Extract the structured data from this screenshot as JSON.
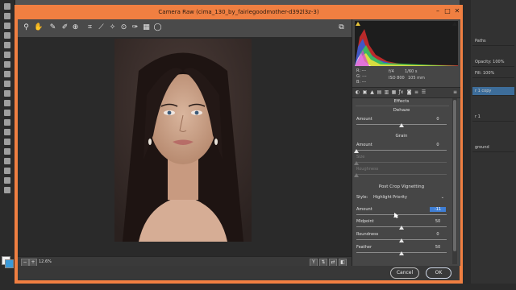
{
  "window": {
    "title": "Camera Raw (cima_130_by_fairiegoodmother-d392l3z-3)"
  },
  "toolbar": {
    "tools": [
      "zoom-tool",
      "hand-tool",
      "white-balance-tool",
      "color-sampler-tool",
      "targeted-adjustment-tool",
      "crop-tool",
      "straighten-tool",
      "spot-removal-tool",
      "red-eye-tool",
      "adjustment-brush",
      "graduated-filter",
      "radial-filter",
      "rotate-tool"
    ],
    "open_preferences": "preferences-icon"
  },
  "status": {
    "zoom": "12.6%"
  },
  "camera_info": {
    "r_label": "R:",
    "g_label": "G:",
    "b_label": "B:",
    "r": "---",
    "g": "---",
    "b": "---",
    "aperture": "f/4",
    "shutter": "1/60 s",
    "iso": "ISO 800",
    "focal": "105 mm"
  },
  "effects": {
    "panel_title": "Effects",
    "dehaze": {
      "title": "Dehaze",
      "amount_label": "Amount",
      "amount": "0"
    },
    "grain": {
      "title": "Grain",
      "amount_label": "Amount",
      "amount": "0",
      "size_label": "Size",
      "roughness_label": "Roughness"
    },
    "vignette": {
      "title": "Post Crop Vignetting",
      "style_label": "Style:",
      "style_value": "Highlight Priority",
      "amount_label": "Amount",
      "amount": "-11",
      "midpoint_label": "Midpoint",
      "midpoint": "50",
      "roundness_label": "Roundness",
      "roundness": "0",
      "feather_label": "Feather",
      "feather": "50"
    }
  },
  "buttons": {
    "cancel": "Cancel",
    "ok": "OK"
  },
  "ps_panels": {
    "paths": "Paths",
    "opacity_label": "Opacity:",
    "opacity": "100%",
    "fill_label": "Fill:",
    "fill": "100%",
    "layer1": "r 1 copy",
    "layer2": "r 1",
    "layer3": "ground"
  },
  "colors": {
    "dialog_frame": "#f07f41",
    "selection": "#3f7fd6"
  }
}
